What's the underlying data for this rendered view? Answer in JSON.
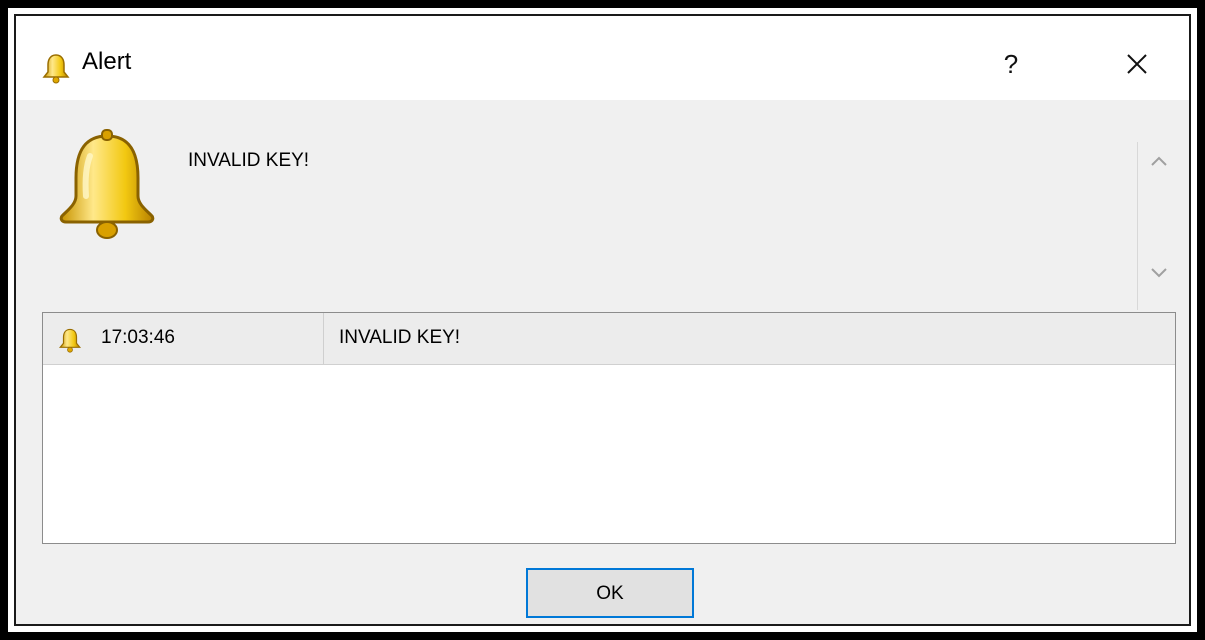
{
  "window": {
    "title": "Alert",
    "help_label": "?",
    "close_icon": "close-icon"
  },
  "alert": {
    "icon": "bell-icon",
    "message": "INVALID KEY!"
  },
  "log": {
    "rows": [
      {
        "icon": "bell-icon",
        "time": "17:03:46",
        "message": "INVALID KEY!"
      }
    ]
  },
  "buttons": {
    "ok_label": "OK"
  },
  "colors": {
    "bell": "#f2c811",
    "focus_border": "#0078d7"
  }
}
